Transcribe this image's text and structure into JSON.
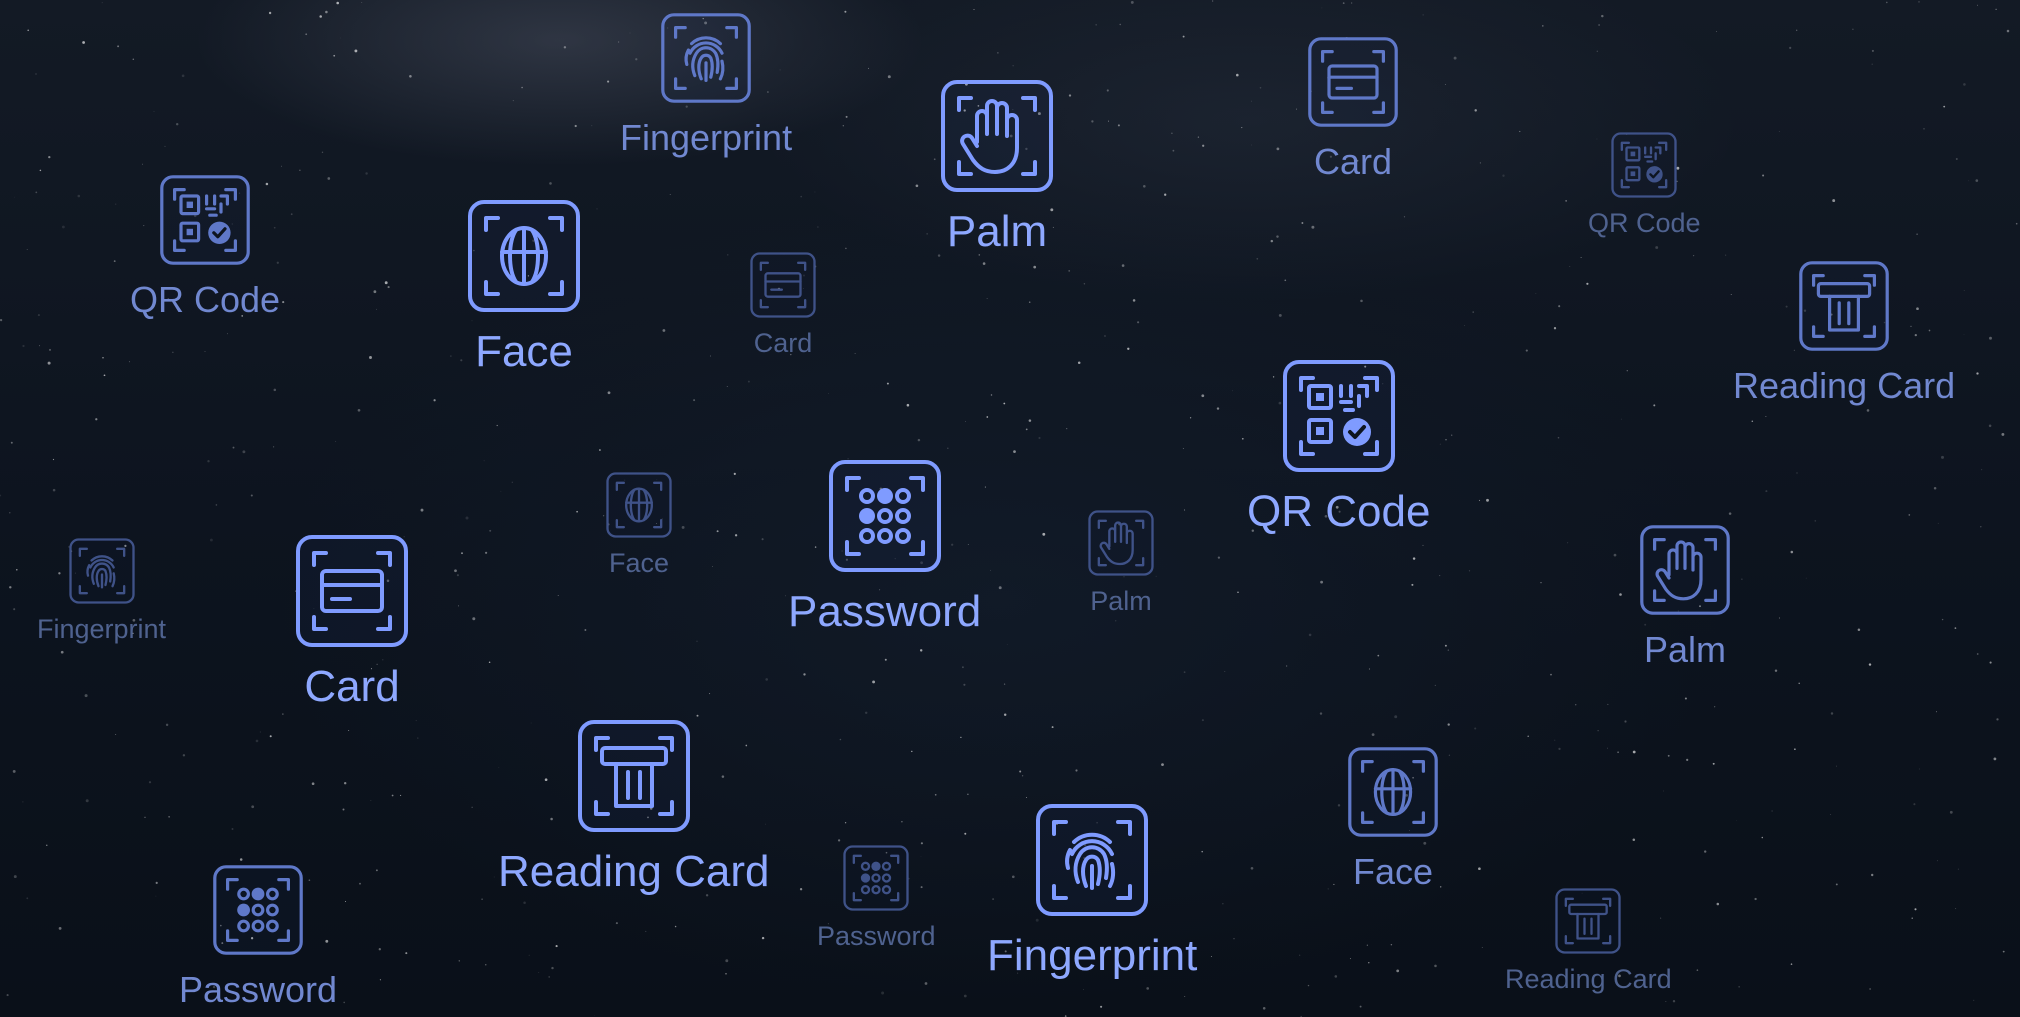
{
  "methods": [
    {
      "label": "Fingerprint",
      "icon": "fingerprint-icon",
      "emphasis": "medium"
    },
    {
      "label": "Palm",
      "icon": "palm-icon",
      "emphasis": "primary"
    },
    {
      "label": "Card",
      "icon": "card-icon",
      "emphasis": "medium"
    },
    {
      "label": "QR Code",
      "icon": "qr-code-icon",
      "emphasis": "faint"
    },
    {
      "label": "QR Code",
      "icon": "qr-code-icon",
      "emphasis": "medium"
    },
    {
      "label": "Face",
      "icon": "face-icon",
      "emphasis": "primary"
    },
    {
      "label": "Card",
      "icon": "card-icon",
      "emphasis": "faint"
    },
    {
      "label": "Reading Card",
      "icon": "reading-card-icon",
      "emphasis": "medium"
    },
    {
      "label": "QR Code",
      "icon": "qr-code-icon",
      "emphasis": "primary"
    },
    {
      "label": "Face",
      "icon": "face-icon",
      "emphasis": "faint"
    },
    {
      "label": "Password",
      "icon": "password-icon",
      "emphasis": "primary"
    },
    {
      "label": "Palm",
      "icon": "palm-icon",
      "emphasis": "faint"
    },
    {
      "label": "Fingerprint",
      "icon": "fingerprint-icon",
      "emphasis": "faint"
    },
    {
      "label": "Card",
      "icon": "card-icon",
      "emphasis": "primary"
    },
    {
      "label": "Palm",
      "icon": "palm-icon",
      "emphasis": "medium"
    },
    {
      "label": "Reading Card",
      "icon": "reading-card-icon",
      "emphasis": "primary"
    },
    {
      "label": "Face",
      "icon": "face-icon",
      "emphasis": "medium"
    },
    {
      "label": "Password",
      "icon": "password-icon",
      "emphasis": "faint"
    },
    {
      "label": "Fingerprint",
      "icon": "fingerprint-icon",
      "emphasis": "primary"
    },
    {
      "label": "Password",
      "icon": "password-icon",
      "emphasis": "medium"
    },
    {
      "label": "Reading Card",
      "icon": "reading-card-icon",
      "emphasis": "faint"
    }
  ]
}
